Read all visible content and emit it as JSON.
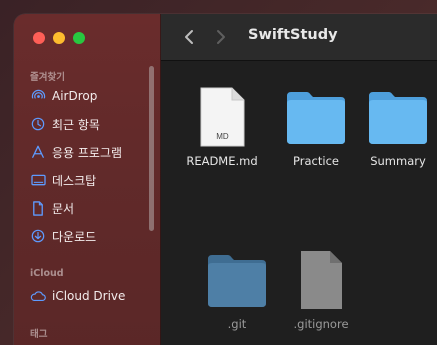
{
  "window": {
    "traffic_lights": [
      "close",
      "minimize",
      "zoom"
    ],
    "title": "SwiftStudy"
  },
  "sidebar": {
    "favorites_label": "즐겨찾기",
    "favorites": [
      {
        "label": "AirDrop",
        "icon": "airdrop-icon"
      },
      {
        "label": "최근 항목",
        "icon": "clock-icon"
      },
      {
        "label": "응용 프로그램",
        "icon": "applications-icon"
      },
      {
        "label": "데스크탑",
        "icon": "desktop-icon"
      },
      {
        "label": "문서",
        "icon": "document-icon"
      },
      {
        "label": "다운로드",
        "icon": "download-icon"
      }
    ],
    "icloud_label": "iCloud",
    "icloud": [
      {
        "label": "iCloud Drive",
        "icon": "cloud-icon"
      }
    ],
    "tags_label": "태그"
  },
  "files": [
    {
      "name": "README.md",
      "kind": "document",
      "badge": "MD",
      "hidden": false
    },
    {
      "name": "Practice",
      "kind": "folder",
      "hidden": false
    },
    {
      "name": "Summary",
      "kind": "folder",
      "hidden": false
    },
    {
      "name": ".git",
      "kind": "folder",
      "hidden": true
    },
    {
      "name": ".gitignore",
      "kind": "document",
      "hidden": true
    }
  ],
  "colors": {
    "sidebar_accent": "#5e9bff",
    "folder": "#5fb3ee",
    "folder_dim": "#4a7fa7"
  }
}
